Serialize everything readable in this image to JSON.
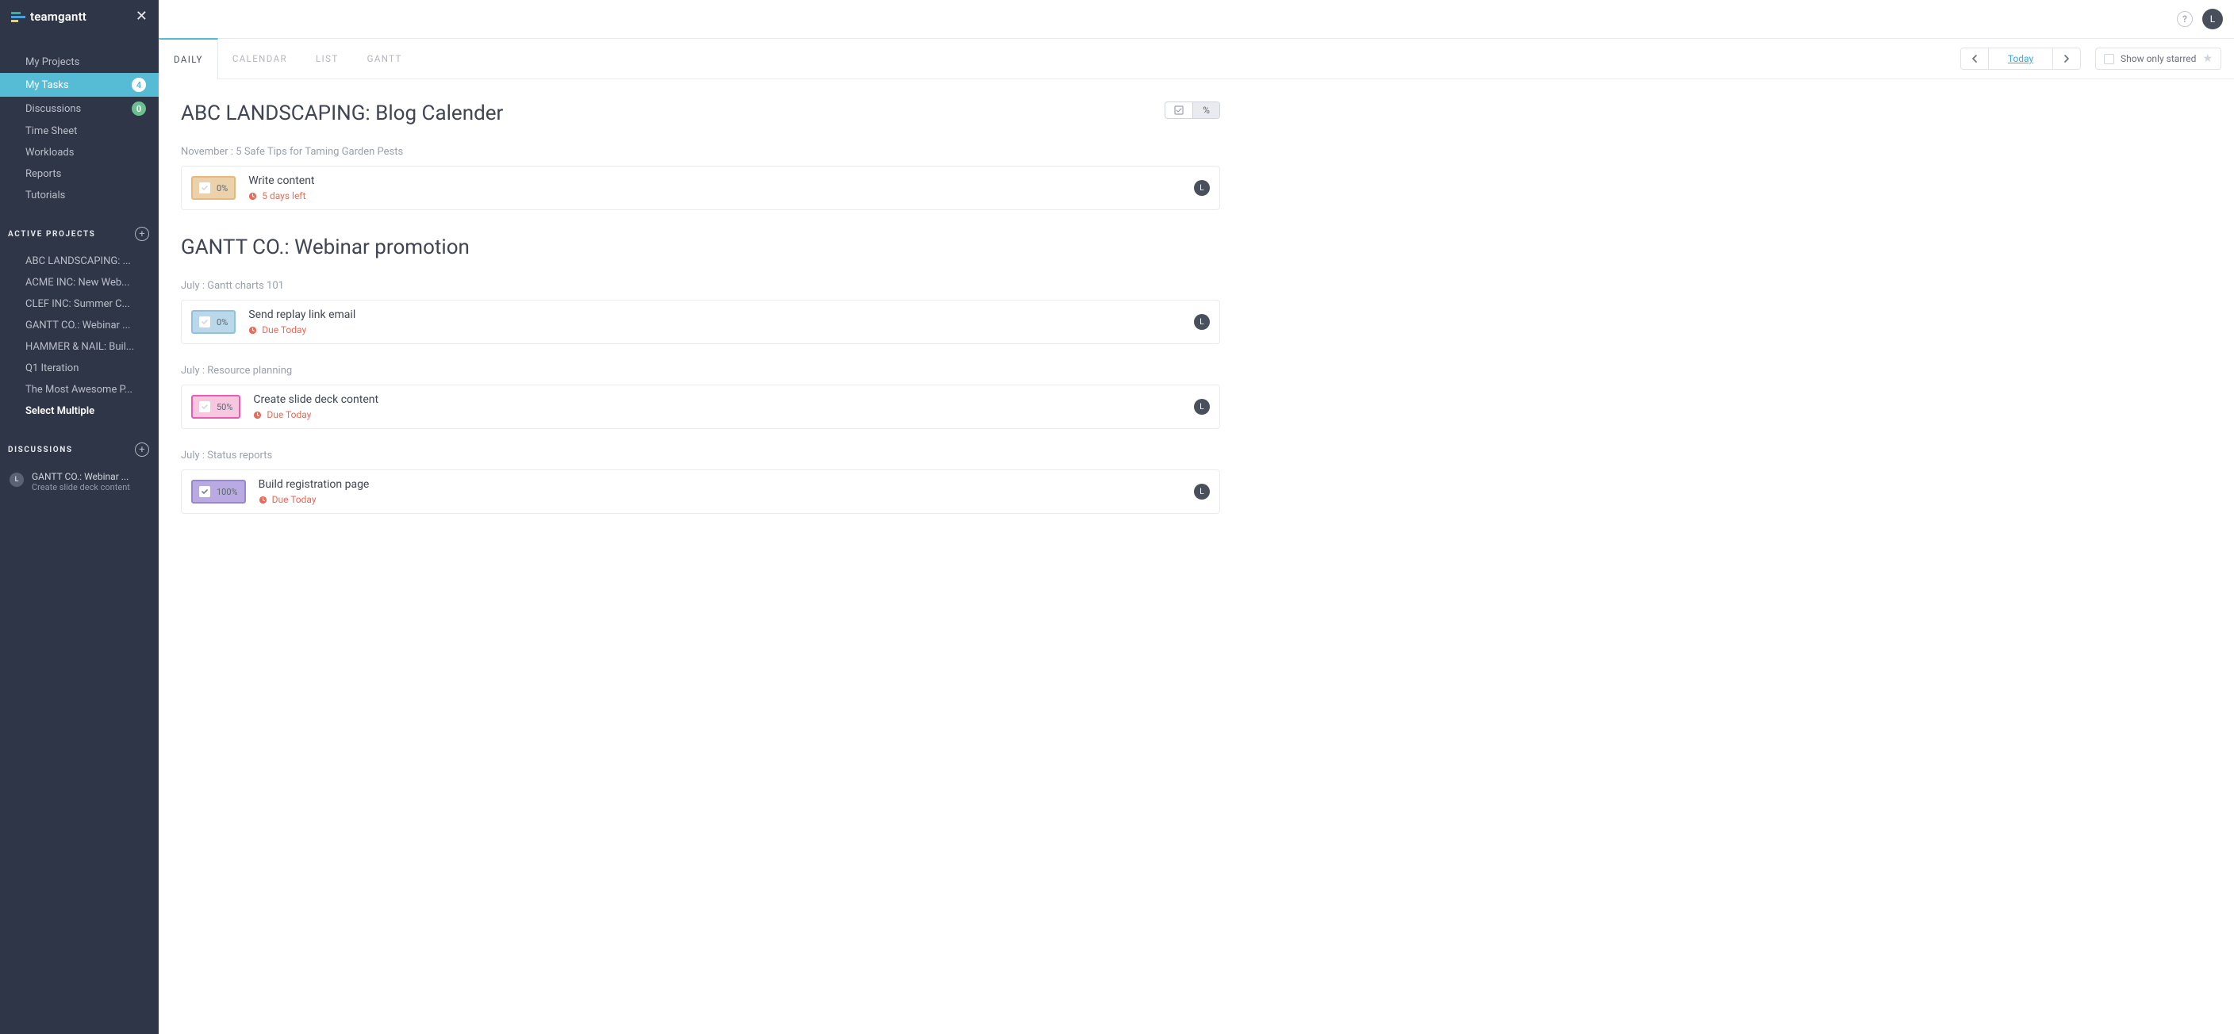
{
  "brand": {
    "name": "teamgantt"
  },
  "topbar": {
    "user_initial": "L"
  },
  "sidebar": {
    "nav": [
      {
        "label": "My Projects",
        "badge": "",
        "badge_style": ""
      },
      {
        "label": "My Tasks",
        "badge": "4",
        "badge_style": "white",
        "active": true
      },
      {
        "label": "Discussions",
        "badge": "0",
        "badge_style": "green"
      },
      {
        "label": "Time Sheet"
      },
      {
        "label": "Workloads"
      },
      {
        "label": "Reports"
      },
      {
        "label": "Tutorials"
      }
    ],
    "active_projects_title": "ACTIVE PROJECTS",
    "projects": [
      {
        "label": "ABC LANDSCAPING: ..."
      },
      {
        "label": "ACME INC: New Web..."
      },
      {
        "label": "CLEF INC: Summer C..."
      },
      {
        "label": "GANTT CO.: Webinar ..."
      },
      {
        "label": "HAMMER & NAIL: Buil..."
      },
      {
        "label": "Q1 Iteration"
      },
      {
        "label": "The Most Awesome P..."
      },
      {
        "label": "Select Multiple",
        "bold": true
      }
    ],
    "discussions_title": "DISCUSSIONS",
    "discussions": [
      {
        "avatar": "L",
        "title": "GANTT CO.: Webinar ...",
        "subtitle": "Create slide deck content"
      }
    ]
  },
  "tabs": {
    "items": [
      {
        "label": "DAILY",
        "active": true
      },
      {
        "label": "CALENDAR"
      },
      {
        "label": "LIST"
      },
      {
        "label": "GANTT"
      }
    ],
    "today_label": "Today",
    "show_starred_label": "Show only starred"
  },
  "seg": {
    "percent_label": "%"
  },
  "content": {
    "sections": [
      {
        "title": "ABC LANDSCAPING: Blog Calender",
        "groups": [
          {
            "label": "November : 5 Safe Tips for Taming Garden Pests",
            "tasks": [
              {
                "pct": "0%",
                "chip": "tan",
                "name": "Write content",
                "due": "5 days left",
                "assignee": "L",
                "checked": false
              }
            ]
          }
        ]
      },
      {
        "title": "GANTT CO.: Webinar promotion",
        "groups": [
          {
            "label": "July : Gantt charts 101",
            "tasks": [
              {
                "pct": "0%",
                "chip": "blue",
                "name": "Send replay link email",
                "due": "Due Today",
                "assignee": "L",
                "checked": false
              }
            ]
          },
          {
            "label": "July : Resource planning",
            "tasks": [
              {
                "pct": "50%",
                "chip": "pink",
                "name": "Create slide deck content",
                "due": "Due Today",
                "assignee": "L",
                "checked": false
              }
            ]
          },
          {
            "label": "July : Status reports",
            "tasks": [
              {
                "pct": "100%",
                "chip": "purple",
                "name": "Build registration page",
                "due": "Due Today",
                "assignee": "L",
                "checked": true
              }
            ]
          }
        ]
      }
    ]
  }
}
